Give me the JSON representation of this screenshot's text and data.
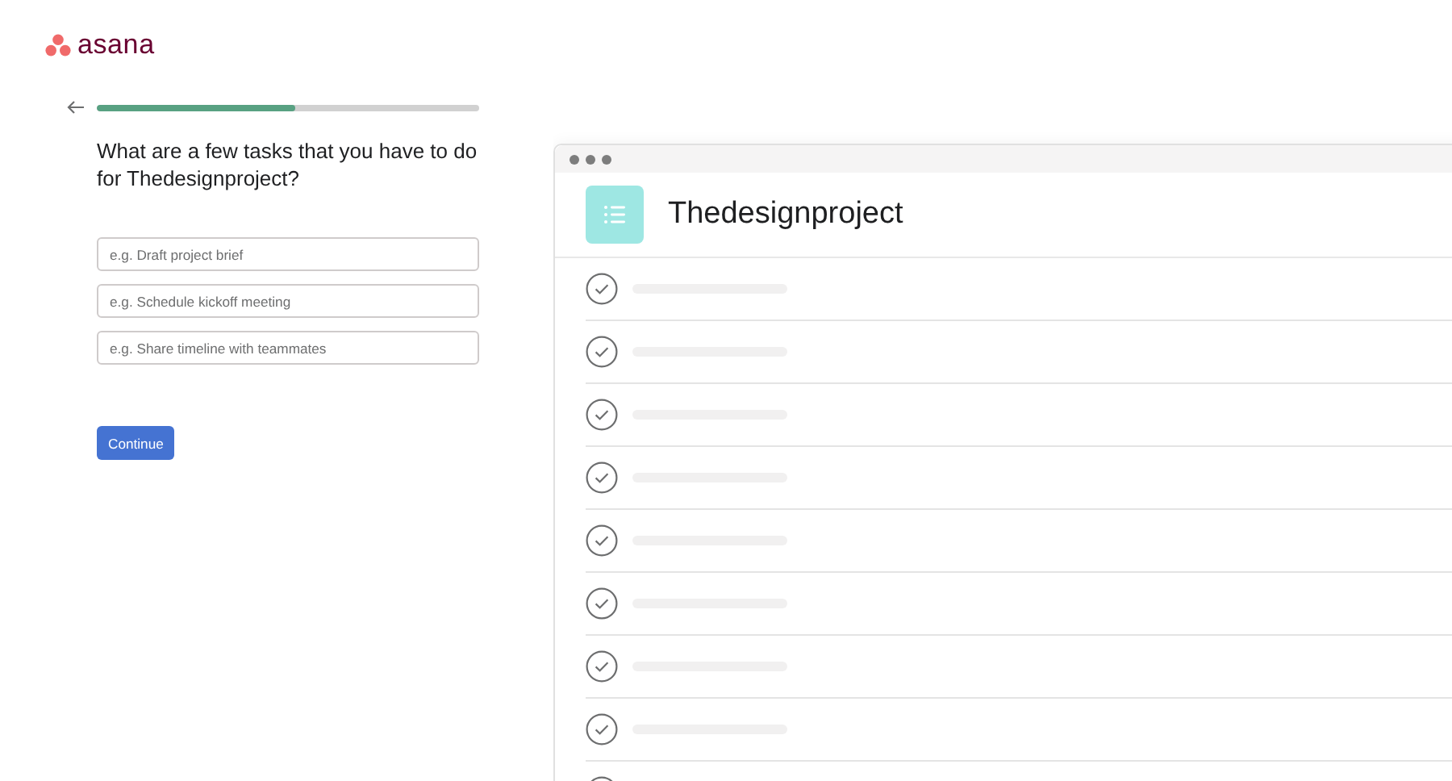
{
  "logo": {
    "wordmark": "asana"
  },
  "progress": {
    "level": 0.52
  },
  "question": "What are a few tasks that you have to do for Thedesignproject?",
  "task_fields": [
    {
      "placeholder": "e.g. Draft project brief"
    },
    {
      "placeholder": "e.g. Schedule kickoff meeting"
    },
    {
      "placeholder": "e.g. Share timeline with teammates"
    }
  ],
  "continue_button": "Continue",
  "preview": {
    "project_title": "Thedesignproject",
    "task_rows": [
      {
        "kind": "skeleton"
      },
      {
        "kind": "skeleton"
      },
      {
        "kind": "skeleton"
      },
      {
        "kind": "skeleton"
      },
      {
        "kind": "skeleton"
      },
      {
        "kind": "skeleton"
      },
      {
        "kind": "skeleton"
      },
      {
        "kind": "skeleton"
      },
      {
        "kind": "cut"
      }
    ]
  }
}
